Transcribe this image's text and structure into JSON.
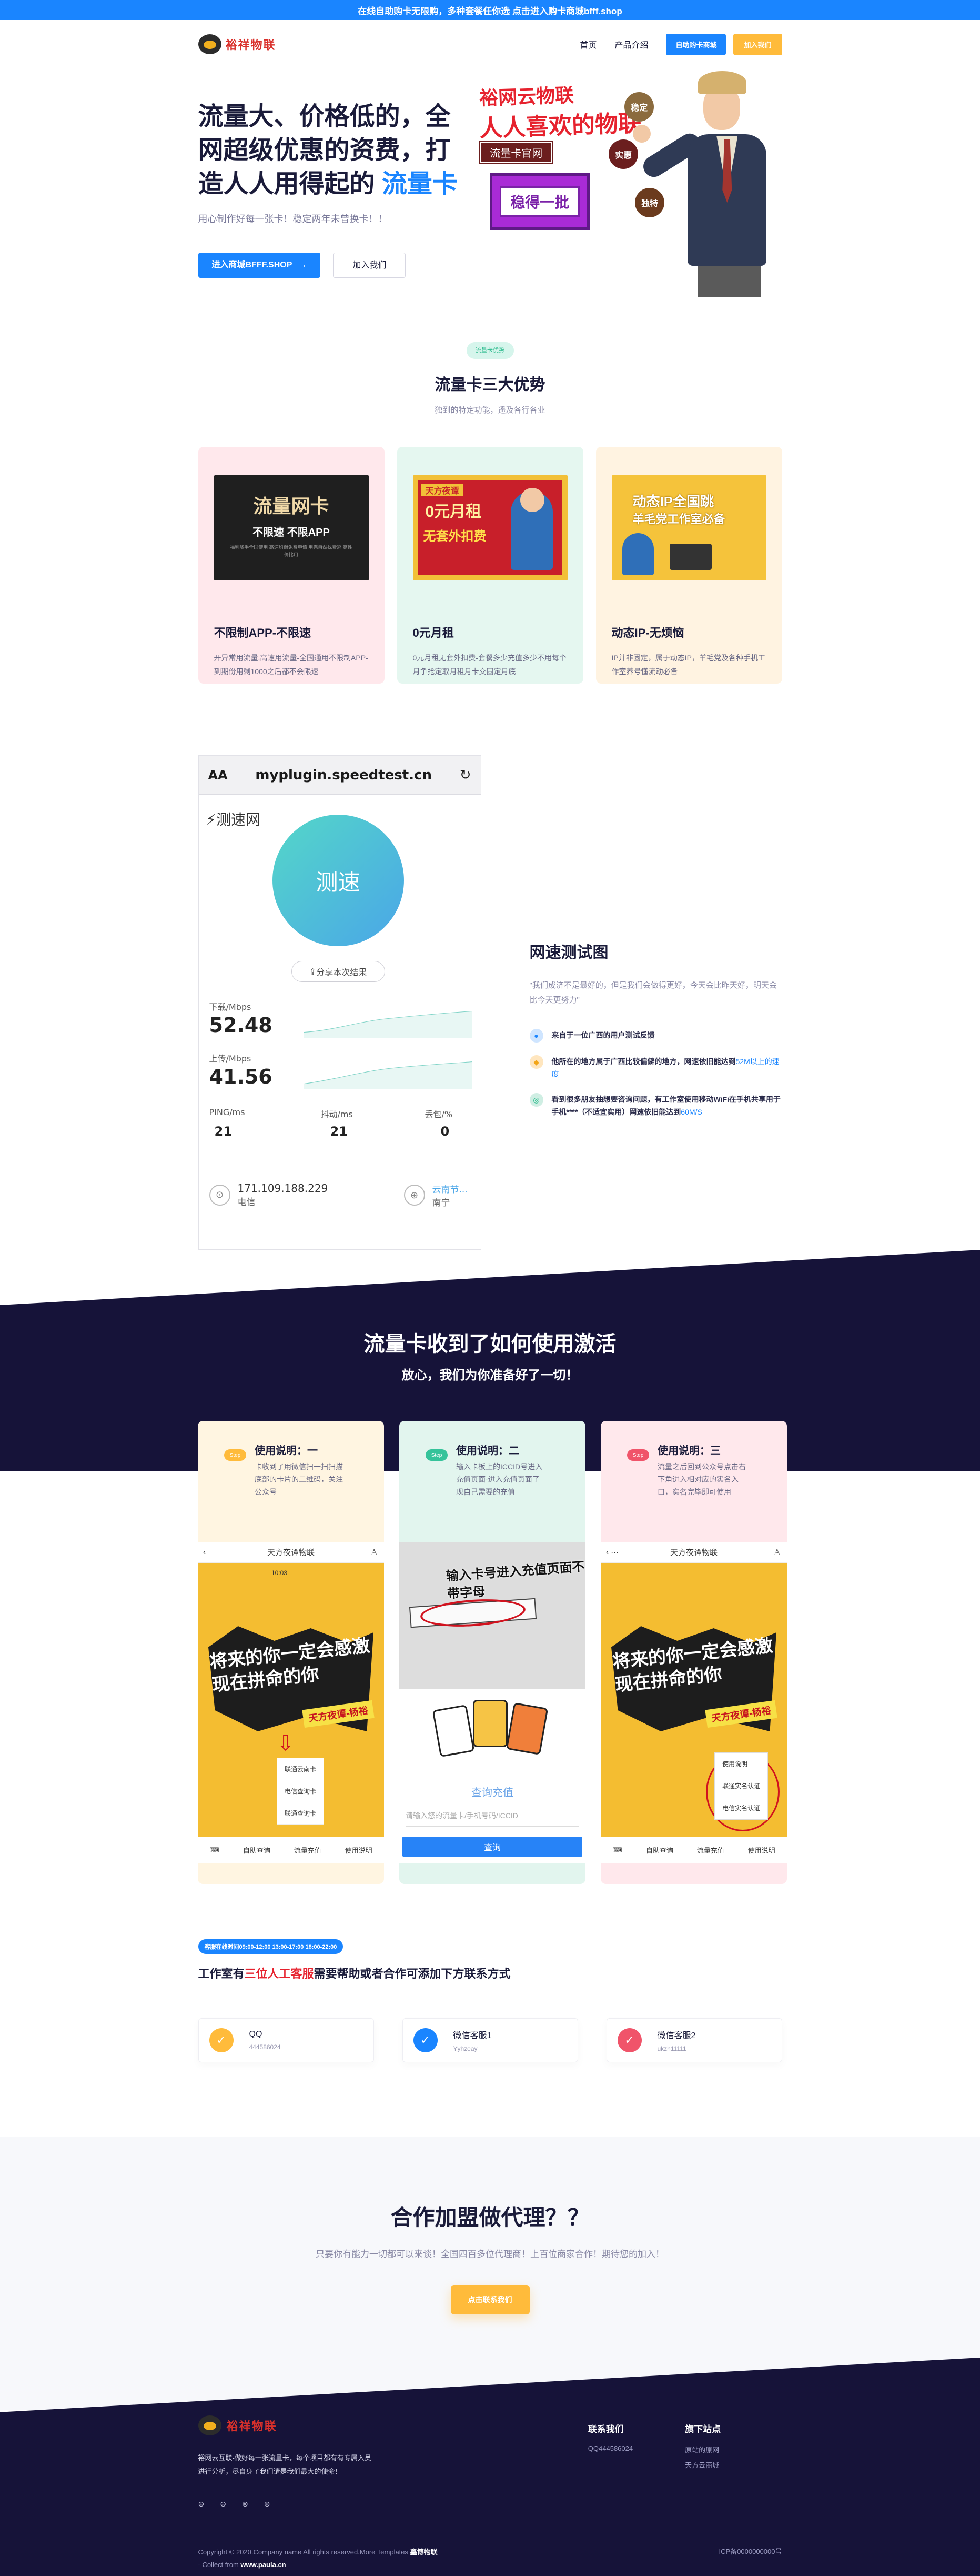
{
  "topbar": {
    "text": "在线自助购卡无限购，多种套餐任你选 点击进入购卡商城bfff.shop"
  },
  "header": {
    "logo_text": "裕祥物联",
    "nav": {
      "home": "首页",
      "products": "产品介绍",
      "shop_btn": "自助购卡商城",
      "join_btn": "加入我们"
    }
  },
  "hero": {
    "title_part1": "流量大、价格低的，全网超级优惠的资费，打造人人用得起的",
    "title_highlight": "流量卡",
    "subtitle": "用心制作好每一张卡！稳定两年未曾换卡！！",
    "primary_btn": "进入商城BFFF.SHOP",
    "secondary_btn": "加入我们",
    "art": {
      "line1": "裕网云物联",
      "line2": "人人喜欢的物联",
      "tag": "流量卡官网",
      "box": "稳得一批",
      "bubbles": [
        "稳定",
        "实惠",
        "独特"
      ]
    }
  },
  "advantages": {
    "pill": "流量卡优势",
    "title": "流量卡三大优势",
    "subtitle": "独到的特定功能，遥及各行各业",
    "cards": [
      {
        "img_title": "流量网卡",
        "img_sub": "不限速 不限APP",
        "img_fine": "福利随手全国使用  高速均衡免费申请  用完自然找费返  高性价比用",
        "title": "不限制APP-不限速",
        "desc": "开异常用流量,高速用流量-全国通用不限制APP-到期份用剩1000之后都不会限速"
      },
      {
        "img_title": "天方夜谭",
        "img_sub": "0元月租",
        "img_fine": "无套外扣费",
        "title": "0元月租",
        "desc": "0元月租无套外扣费-套餐多少充值多少不用每个月争抢定取月租月卡交固定月底"
      },
      {
        "img_title": "动态IP全国跳",
        "img_sub": "羊毛党工作室必备",
        "img_fine": "",
        "title": "动态IP-无烦恼",
        "desc": "IP并非固定，属于动态IP，羊毛党及各种手机工作室养号懂流动必备"
      }
    ]
  },
  "speed": {
    "phone": {
      "aa": "AA",
      "url": "myplugin.speedtest.cn",
      "brand": "测速网",
      "ball": "测速",
      "share": "分享本次结果",
      "download_label": "下载/Mbps",
      "download": "52.48",
      "upload_label": "上传/Mbps",
      "upload": "41.56",
      "ping_label": "PING/ms",
      "ping": "21",
      "jitter_label": "抖动/ms",
      "jitter": "21",
      "loss_label": "丢包/%",
      "loss": "0",
      "ip": "171.109.188.229",
      "carrier": "电信",
      "node": "云南节...",
      "node_city": "南宁"
    },
    "title": "网速测试图",
    "quote": "\"我们成济不是最好的，但是我们会做得更好，今天会比昨天好，明天会比今天更努力\"",
    "features": [
      {
        "text": "来自于一位广西的用户测试反馈",
        "hl": ""
      },
      {
        "text": "他所在的地方属于广西比较偏僻的地方，网速依旧能达到",
        "hl": "52M以上的速度"
      },
      {
        "text": "看到很多朋友抽想要咨询问题，有工作室使用移动WiFi在手机共享用于手机****（不适宜实用）网速依旧能达到",
        "hl": "60M/S"
      }
    ]
  },
  "howto": {
    "title": "流量卡收到了如何使用激活",
    "subtitle": "放心，我们为你准备好了一切！",
    "steps": [
      {
        "tag": "Step",
        "title": "使用说明：一",
        "desc": "卡收到了用微信扫一扫扫描底部的卡片的二维码，关注公众号",
        "bar": "天方夜谭物联",
        "time": "10:03",
        "poster_text": "将来的你一定会感激现在拼命的你",
        "poster_tag": "天方夜谭-杨裕",
        "menu": [
          "联通云南卡",
          "电信查询卡",
          "联通查询卡"
        ],
        "tabs": [
          "自助查询",
          "流量充值",
          "使用说明"
        ]
      },
      {
        "tag": "Step",
        "title": "使用说明：二",
        "desc": "输入卡板上的ICCID号进入充值页面-进入充值页面了现自己需要的充值",
        "photo_text": "输入卡号进入充值页面不带字母",
        "query": "查询充值",
        "input_placeholder": "请输入您的流量卡/手机号码/ICCID",
        "btn": "查询"
      },
      {
        "tag": "Step",
        "title": "使用说明：三",
        "desc": "流量之后回到公众号点击右下角进入相对应的实名入口，实名完毕即可使用",
        "bar": "天方夜谭物联",
        "poster_text": "将来的你一定会感激现在拼命的你",
        "poster_tag": "天方夜谭-杨裕",
        "menu": [
          "使用说明",
          "联通实名认证",
          "电信实名认证"
        ],
        "tabs": [
          "自助查询",
          "流量充值",
          "使用说明"
        ]
      }
    ]
  },
  "contact": {
    "hours": "客服在线时间09:00-12:00 13:00-17:00 18:00-22:00",
    "title_a": "工作室有",
    "title_hl": "三位人工客服",
    "title_b": "需要帮助或者合作可添加下方联系方式",
    "items": [
      {
        "name": "QQ",
        "value": "444586024"
      },
      {
        "name": "微信客服1",
        "value": "Yyhzeay"
      },
      {
        "name": "微信客服2",
        "value": "ukzh11111"
      }
    ]
  },
  "join": {
    "title": "合作加盟做代理？？",
    "desc": "只要你有能力一切都可以来谈！全国四百多位代理商！上百位商家合作！期待您的加入！",
    "btn": "点击联系我们"
  },
  "footer": {
    "logo_text": "裕祥物联",
    "about": "裕网云互联-做好每一张流量卡，每个项目都有有专属入员进行分析，尽自身了我们请是我们最大的使命！",
    "socials": [
      "⊕",
      "⊖",
      "⊗",
      "⊛"
    ],
    "col1_title": "联系我们",
    "col1_items": [
      "QQ444586024"
    ],
    "col2_title": "旗下站点",
    "col2_items": [
      "原站的原网",
      "天方云商城"
    ],
    "copy_line1_a": "Copyright © 2020.Company name All rights reserved.More Templates",
    "copy_line1_b": "鑫博物联",
    "copy_line2_a": "- Collect from",
    "copy_line2_b": "www.paula.cn",
    "icp": "ICP备0000000000号"
  },
  "colors": {
    "accent_blue": "#1a85ff",
    "accent_yellow": "#ffbb3b",
    "navy": "#161339",
    "red": "#e6222e"
  }
}
